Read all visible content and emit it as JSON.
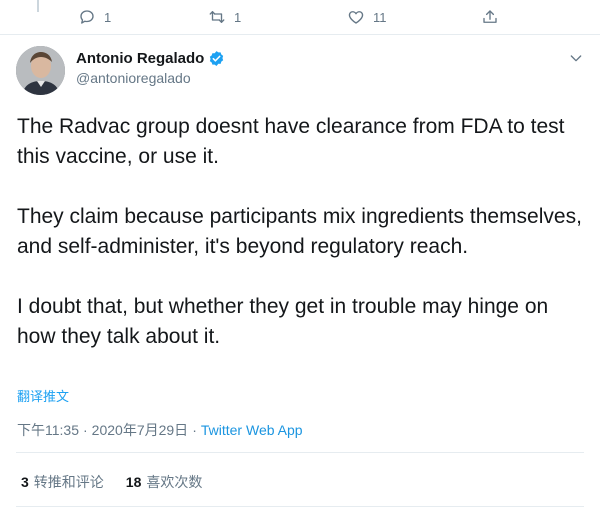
{
  "prev_tweet_actions": {
    "reply_count": "1",
    "retweet_count": "1",
    "like_count": "11"
  },
  "author": {
    "display_name": "Antonio Regalado",
    "handle": "@antonioregalado",
    "verified": true
  },
  "tweet": {
    "paragraphs": [
      "The Radvac group doesnt have clearance from FDA to test this vaccine, or use it.",
      "They claim because participants mix ingredients themselves, and self-administer, it's beyond regulatory reach.",
      "I doubt that, but whether they get in trouble may hinge on how they talk about it."
    ],
    "translate_label": "翻译推文",
    "time": "下午11:35",
    "separator": "·",
    "date": "2020年7月29日",
    "app": "Twitter Web App"
  },
  "stats": {
    "retweets_count": "3",
    "retweets_label": "转推和评论",
    "likes_count": "18",
    "likes_label": "喜欢次数"
  },
  "colors": {
    "accent": "#1da1f2",
    "secondary_text": "#657786",
    "divider": "#e6ecf0"
  },
  "icons": [
    "reply-icon",
    "retweet-icon",
    "like-icon",
    "share-icon",
    "verified-badge-icon",
    "chevron-down-icon"
  ]
}
